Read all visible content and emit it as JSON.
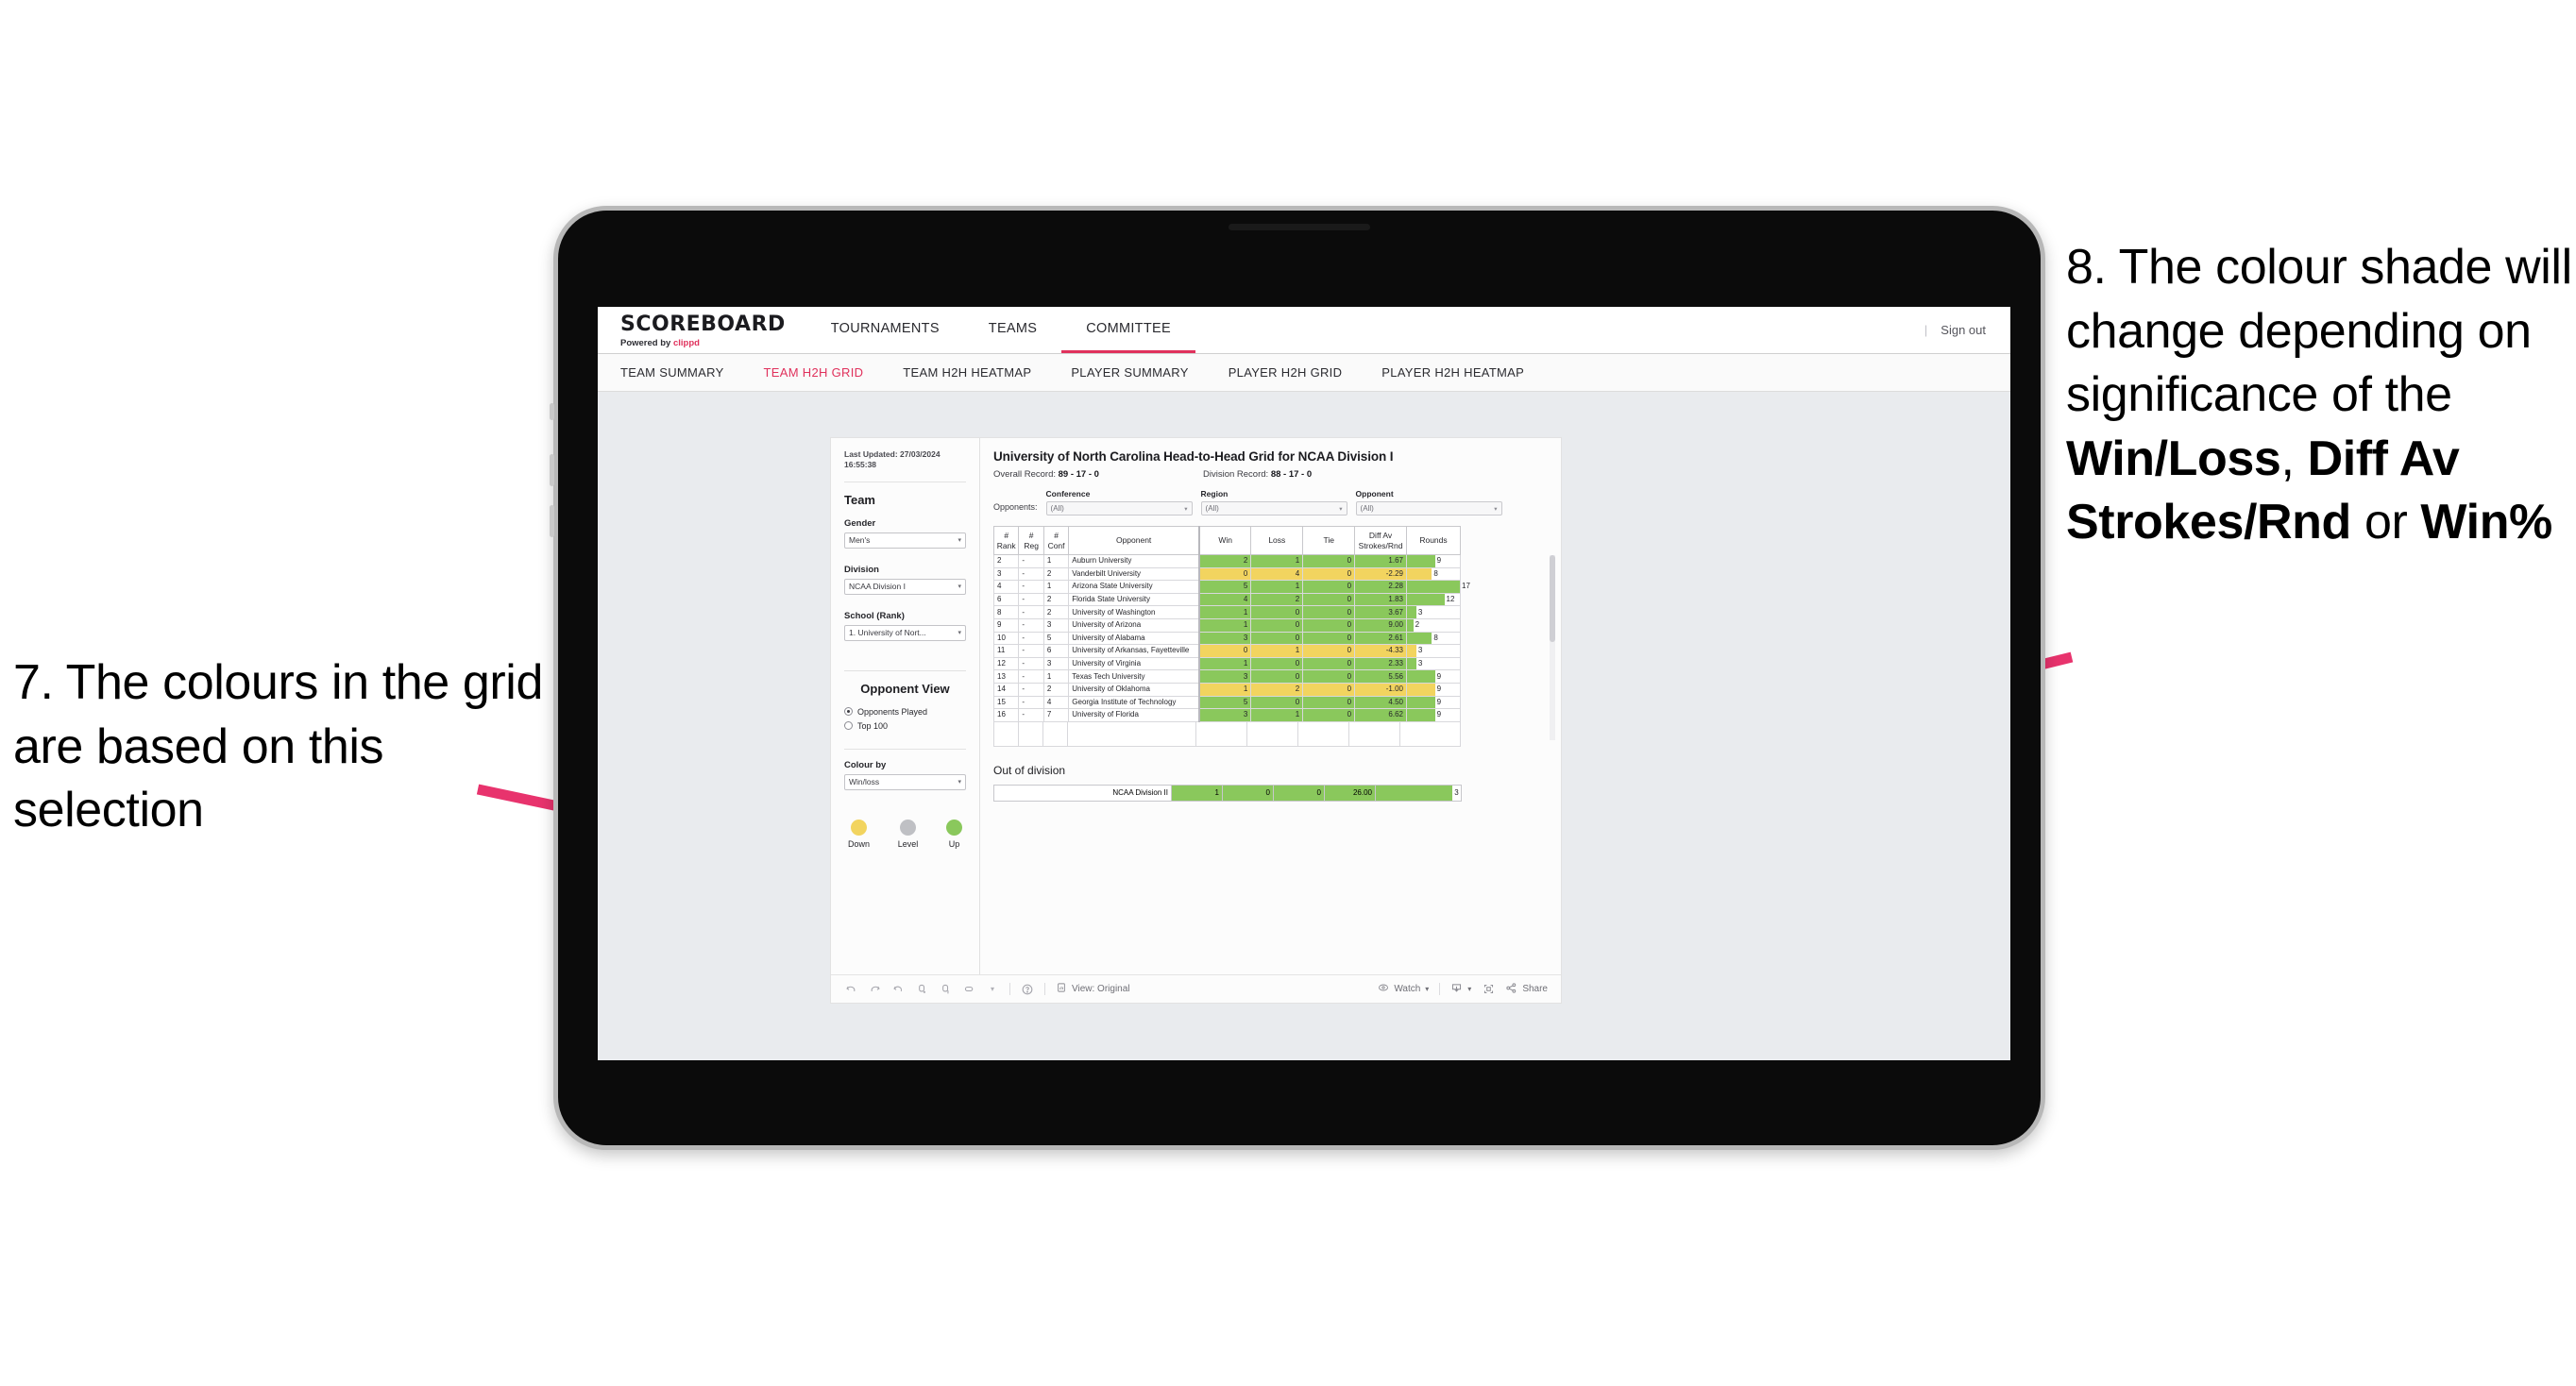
{
  "annotations": {
    "left": {
      "number": "7.",
      "text": "7. The colours in the grid are based on this selection"
    },
    "right": {
      "number": "8.",
      "prefix": "8. The colour shade will change depending on significance of the ",
      "bold1": "Win/Loss",
      "mid1": ", ",
      "bold2": "Diff Av Strokes/Rnd",
      "mid2": " or ",
      "bold3": "Win%"
    },
    "arrow_color": "#e8336d"
  },
  "app": {
    "brand": {
      "title": "SCOREBOARD",
      "powered_prefix": "Powered by ",
      "powered_brand": "clippd"
    },
    "top_nav": [
      {
        "label": "TOURNAMENTS",
        "active": false
      },
      {
        "label": "TEAMS",
        "active": false
      },
      {
        "label": "COMMITTEE",
        "active": true
      }
    ],
    "sign_out": "Sign out",
    "sub_nav": [
      {
        "label": "TEAM SUMMARY",
        "active": false
      },
      {
        "label": "TEAM H2H GRID",
        "active": true
      },
      {
        "label": "TEAM H2H HEATMAP",
        "active": false
      },
      {
        "label": "PLAYER SUMMARY",
        "active": false
      },
      {
        "label": "PLAYER H2H GRID",
        "active": false
      },
      {
        "label": "PLAYER H2H HEATMAP",
        "active": false
      }
    ]
  },
  "panel": {
    "last_updated": "Last Updated: 27/03/2024 16:55:38",
    "team_heading": "Team",
    "gender_label": "Gender",
    "gender_value": "Men's",
    "division_label": "Division",
    "division_value": "NCAA Division I",
    "school_label": "School (Rank)",
    "school_value": "1. University of Nort...",
    "opponent_view_heading": "Opponent View",
    "opponent_view_options": [
      {
        "label": "Opponents Played",
        "selected": true
      },
      {
        "label": "Top 100",
        "selected": false
      }
    ],
    "colour_by_label": "Colour by",
    "colour_by_value": "Win/loss",
    "legend": [
      {
        "label": "Down",
        "color": "#f2d45f"
      },
      {
        "label": "Level",
        "color": "#bfc0c4"
      },
      {
        "label": "Up",
        "color": "#8ac85c"
      }
    ]
  },
  "report": {
    "title": "University of North Carolina Head-to-Head Grid for NCAA Division I",
    "overall_record_label": "Overall Record: ",
    "overall_record_value": "89 - 17 - 0",
    "division_record_label": "Division Record: ",
    "division_record_value": "88 - 17 - 0",
    "opponents_label": "Opponents:",
    "filters": [
      {
        "caption": "Conference",
        "value": "(All)"
      },
      {
        "caption": "Region",
        "value": "(All)"
      },
      {
        "caption": "Opponent",
        "value": "(All)"
      }
    ],
    "columns": [
      "# Rank",
      "# Reg",
      "# Conf",
      "Opponent",
      "Win",
      "Loss",
      "Tie",
      "Diff Av Strokes/Rnd",
      "Rounds"
    ],
    "column_lines": [
      [
        "#",
        "Rank"
      ],
      [
        "#",
        "Reg"
      ],
      [
        "#",
        "Conf"
      ],
      [
        "",
        "Opponent"
      ],
      [
        "",
        "Win"
      ],
      [
        "",
        "Loss"
      ],
      [
        "",
        "Tie"
      ],
      [
        "Diff Av",
        "Strokes/Rnd"
      ],
      [
        "",
        "Rounds"
      ]
    ],
    "rows": [
      {
        "rank": "2",
        "reg": "-",
        "conf": "1",
        "opponent": "Auburn University",
        "win": "2",
        "loss": "1",
        "tie": "0",
        "diff": "1.67",
        "rounds": "9",
        "state": "up"
      },
      {
        "rank": "3",
        "reg": "-",
        "conf": "2",
        "opponent": "Vanderbilt University",
        "win": "0",
        "loss": "4",
        "tie": "0",
        "diff": "-2.29",
        "rounds": "8",
        "state": "down"
      },
      {
        "rank": "4",
        "reg": "-",
        "conf": "1",
        "opponent": "Arizona State University",
        "win": "5",
        "loss": "1",
        "tie": "0",
        "diff": "2.28",
        "rounds": "17",
        "state": "up"
      },
      {
        "rank": "6",
        "reg": "-",
        "conf": "2",
        "opponent": "Florida State University",
        "win": "4",
        "loss": "2",
        "tie": "0",
        "diff": "1.83",
        "rounds": "12",
        "state": "up"
      },
      {
        "rank": "8",
        "reg": "-",
        "conf": "2",
        "opponent": "University of Washington",
        "win": "1",
        "loss": "0",
        "tie": "0",
        "diff": "3.67",
        "rounds": "3",
        "state": "up"
      },
      {
        "rank": "9",
        "reg": "-",
        "conf": "3",
        "opponent": "University of Arizona",
        "win": "1",
        "loss": "0",
        "tie": "0",
        "diff": "9.00",
        "rounds": "2",
        "state": "up"
      },
      {
        "rank": "10",
        "reg": "-",
        "conf": "5",
        "opponent": "University of Alabama",
        "win": "3",
        "loss": "0",
        "tie": "0",
        "diff": "2.61",
        "rounds": "8",
        "state": "up"
      },
      {
        "rank": "11",
        "reg": "-",
        "conf": "6",
        "opponent": "University of Arkansas, Fayetteville",
        "win": "0",
        "loss": "1",
        "tie": "0",
        "diff": "-4.33",
        "rounds": "3",
        "state": "down"
      },
      {
        "rank": "12",
        "reg": "-",
        "conf": "3",
        "opponent": "University of Virginia",
        "win": "1",
        "loss": "0",
        "tie": "0",
        "diff": "2.33",
        "rounds": "3",
        "state": "up"
      },
      {
        "rank": "13",
        "reg": "-",
        "conf": "1",
        "opponent": "Texas Tech University",
        "win": "3",
        "loss": "0",
        "tie": "0",
        "diff": "5.56",
        "rounds": "9",
        "state": "up"
      },
      {
        "rank": "14",
        "reg": "-",
        "conf": "2",
        "opponent": "University of Oklahoma",
        "win": "1",
        "loss": "2",
        "tie": "0",
        "diff": "-1.00",
        "rounds": "9",
        "state": "down"
      },
      {
        "rank": "15",
        "reg": "-",
        "conf": "4",
        "opponent": "Georgia Institute of Technology",
        "win": "5",
        "loss": "0",
        "tie": "0",
        "diff": "4.50",
        "rounds": "9",
        "state": "up"
      },
      {
        "rank": "16",
        "reg": "-",
        "conf": "7",
        "opponent": "University of Florida",
        "win": "3",
        "loss": "1",
        "tie": "0",
        "diff": "6.62",
        "rounds": "9",
        "state": "up"
      }
    ],
    "out_of_division_title": "Out of division",
    "out_of_division_rows": [
      {
        "opponent": "NCAA Division II",
        "win": "1",
        "loss": "0",
        "tie": "0",
        "diff": "26.00",
        "rounds": "3",
        "state": "up"
      }
    ],
    "rounds_max": 17,
    "colors": {
      "up": "#8ac85c",
      "down": "#f2d45f",
      "level": "#bfc0c4"
    }
  },
  "toolbar": {
    "view_label": "View: Original",
    "watch_label": "Watch",
    "share_label": "Share",
    "icons": [
      "undo-icon",
      "redo-icon",
      "revert-icon",
      "refresh-icon",
      "pause-icon",
      "highlight-icon",
      "caret-down-icon",
      "help-icon",
      "view-icon",
      "watch-icon",
      "download-icon",
      "fullscreen-icon",
      "share-icon"
    ]
  }
}
